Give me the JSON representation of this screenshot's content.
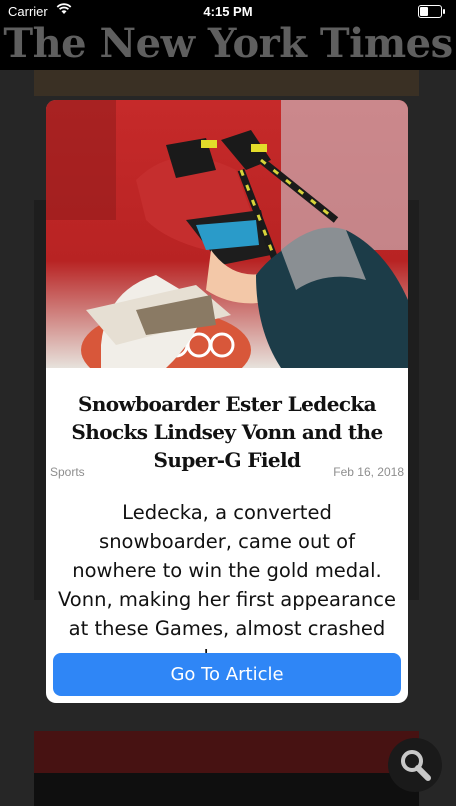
{
  "status_bar": {
    "carrier": "Carrier",
    "time": "4:15 PM"
  },
  "masthead": {
    "title": "The New York Times"
  },
  "article": {
    "image_alt": "Skier Ester Ledecka celebrating with ski poles at the Olympics",
    "headline": "Snowboarder Ester Ledecka Shocks Lindsey Vonn and the Super-G Field",
    "section": "Sports",
    "date": "Feb 16, 2018",
    "summary": "Ledecka, a converted snowboarder, came out of nowhere to win the gold medal. Vonn, making her first appearance at these Games, almost crashed on her run.",
    "cta_label": "Go To Article"
  },
  "colors": {
    "accent": "#2f86f6",
    "background": "#3b3b3b"
  },
  "icons": {
    "search": "search-icon",
    "wifi": "wifi-icon",
    "battery": "battery-icon"
  }
}
